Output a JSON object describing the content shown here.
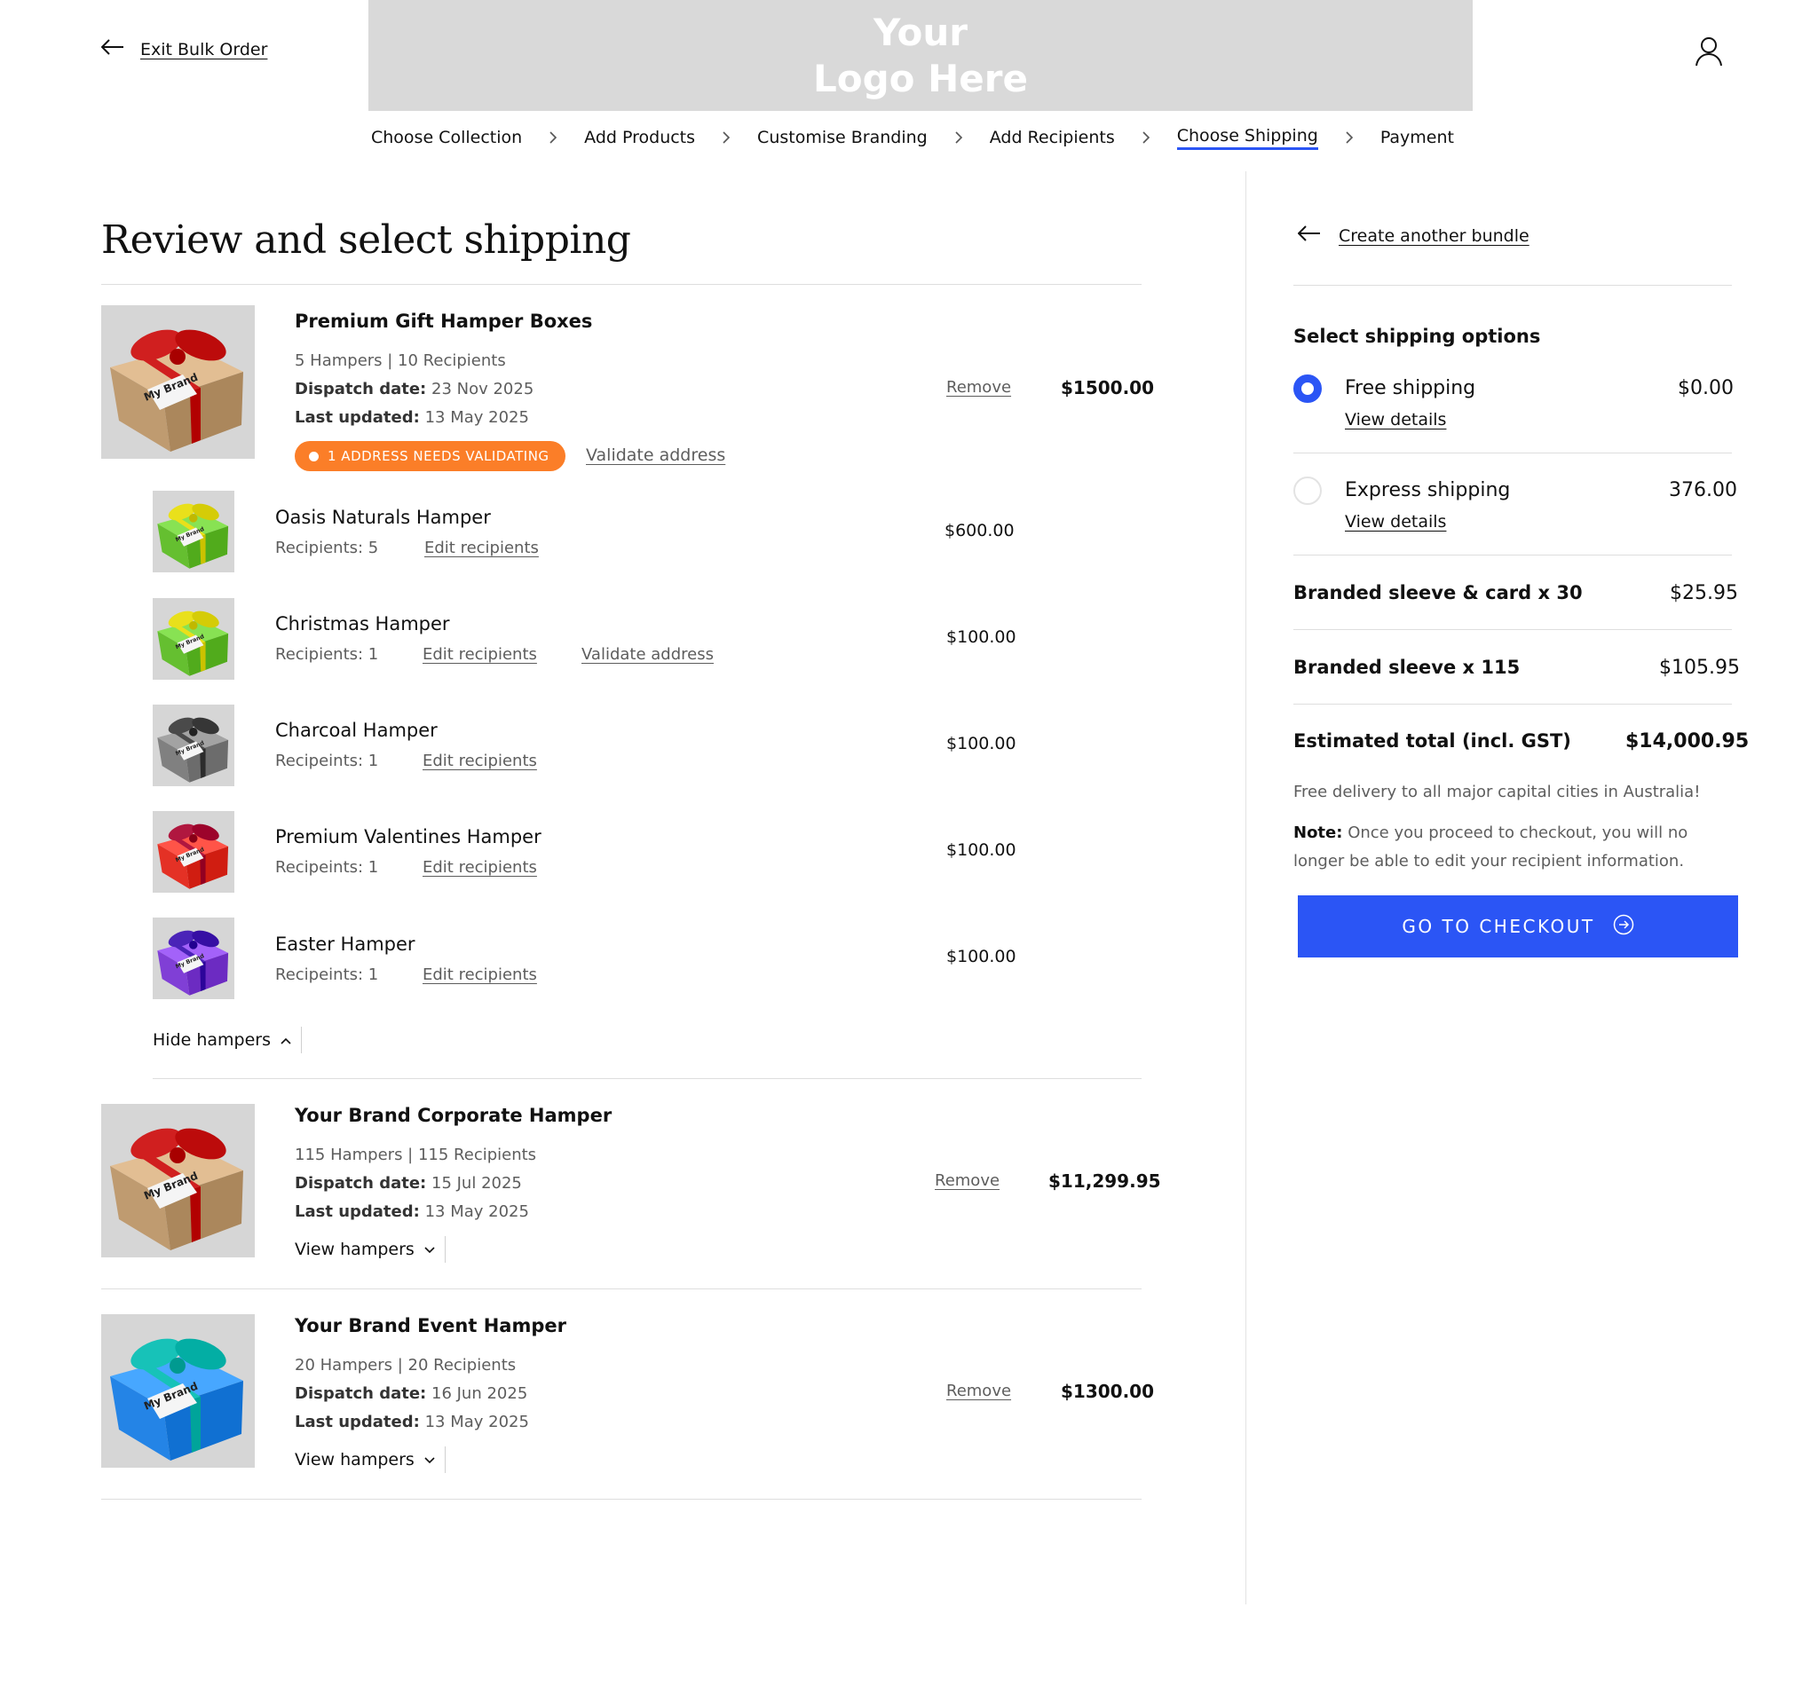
{
  "header": {
    "exit_label": "Exit Bulk Order",
    "logo_line1": "Your",
    "logo_line2": "Logo Here"
  },
  "steps": [
    {
      "label": "Choose Collection"
    },
    {
      "label": "Add Products"
    },
    {
      "label": "Customise Branding"
    },
    {
      "label": "Add Recipients"
    },
    {
      "label": "Choose Shipping",
      "active": true
    },
    {
      "label": "Payment"
    }
  ],
  "main": {
    "title": "Review and select shipping",
    "bundles": [
      {
        "title": "Premium Gift Hamper Boxes",
        "summary": "5 Hampers | 10 Recipients",
        "dispatch_label": "Dispatch date:",
        "dispatch_value": "23 Nov 2025",
        "updated_label": "Last updated:",
        "updated_value": "13 May 2025",
        "badge": "1 ADDRESS NEEDS VALIDATING",
        "validate_label": "Validate address",
        "remove_label": "Remove",
        "price": "$1500.00",
        "toggle_label": "Hide hampers",
        "image_label": "My Brand",
        "box_color": "#c9a57a",
        "ribbon_color": "#d01f1f",
        "hampers": [
          {
            "name": "Oasis Naturals Hamper",
            "recipients": "Recipients: 5",
            "edit": "Edit recipients",
            "price": "$600.00",
            "box_color": "#6fc93a",
            "ribbon_color": "#e9e01b"
          },
          {
            "name": "Christmas Hamper",
            "recipients": "Recipients: 1",
            "edit": "Edit recipients",
            "validate": "Validate address",
            "price": "$100.00",
            "box_color": "#6fc93a",
            "ribbon_color": "#e9e01b"
          },
          {
            "name": "Charcoal Hamper",
            "recipients": "Recipeints: 1",
            "edit": "Edit recipients",
            "price": "$100.00",
            "box_color": "#8a8a8a",
            "ribbon_color": "#4a4a4a"
          },
          {
            "name": "Premium Valentines Hamper",
            "recipients": "Recipeints: 1",
            "edit": "Edit recipients",
            "price": "$100.00",
            "box_color": "#ee3b2f",
            "ribbon_color": "#b0173f"
          },
          {
            "name": "Easter Hamper",
            "recipients": "Recipeints: 1",
            "edit": "Edit recipients",
            "price": "$100.00",
            "box_color": "#8a49e0",
            "ribbon_color": "#4a23b8"
          }
        ]
      },
      {
        "title": "Your Brand Corporate Hamper",
        "summary": "115 Hampers | 115 Recipients",
        "dispatch_label": "Dispatch date:",
        "dispatch_value": "15 Jul 2025",
        "updated_label": "Last updated:",
        "updated_value": "13 May 2025",
        "remove_label": "Remove",
        "price": "$11,299.95",
        "toggle_label": "View hampers",
        "image_label": "My Brand",
        "box_color": "#c9a57a",
        "ribbon_color": "#d01f1f"
      },
      {
        "title": "Your Brand Event Hamper",
        "summary": "20 Hampers | 20 Recipients",
        "dispatch_label": "Dispatch date:",
        "dispatch_value": "16 Jun 2025",
        "updated_label": "Last updated:",
        "updated_value": "13 May 2025",
        "remove_label": "Remove",
        "price": "$1300.00",
        "toggle_label": "View hampers",
        "image_label": "My Brand",
        "box_color": "#2e8ef0",
        "ribbon_color": "#17c2b8"
      }
    ]
  },
  "sidebar": {
    "back_label": "Create another bundle",
    "shipping_heading": "Select shipping options",
    "options": [
      {
        "name": "Free shipping",
        "details": "View details",
        "price": "$0.00",
        "selected": true
      },
      {
        "name": "Express shipping",
        "details": "View details",
        "price": "376.00",
        "selected": false
      }
    ],
    "lines": [
      {
        "label": "Branded sleeve & card x 30",
        "price": "$25.95"
      },
      {
        "label": "Branded sleeve x 115",
        "price": "$105.95"
      }
    ],
    "total_label": "Estimated total (incl. GST)",
    "total_value": "$14,000.95",
    "delivery_note": "Free delivery to all major capital cities in Australia!",
    "note_label": "Note:",
    "note_text": "Once you proceed to checkout, you will no longer be able to edit your recipient information.",
    "checkout_label": "GO TO CHECKOUT"
  },
  "colors": {
    "accent": "#2b55f5",
    "badge": "#fb7e28",
    "logo_bg": "#d9d9d9"
  }
}
